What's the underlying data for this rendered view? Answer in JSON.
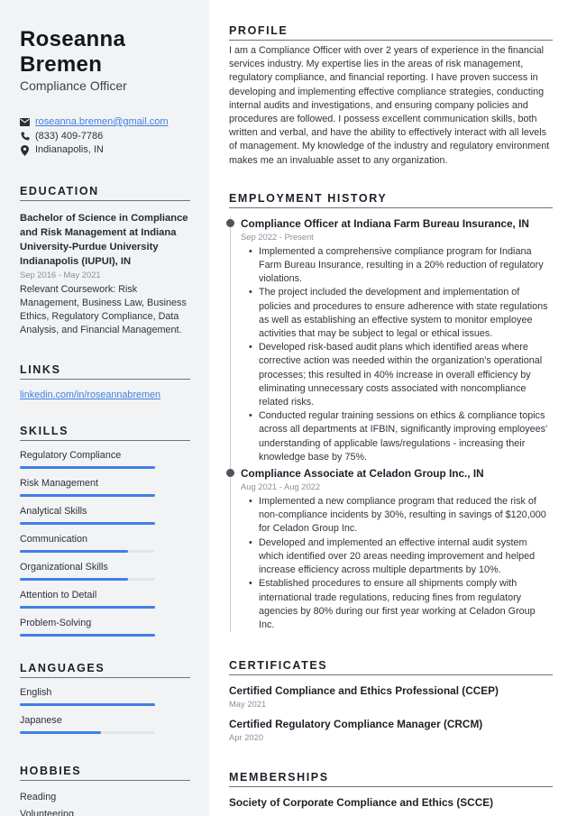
{
  "person": {
    "first_name": "Roseanna",
    "last_name": "Bremen",
    "title": "Compliance Officer"
  },
  "contacts": [
    {
      "icon": "envelope-icon",
      "value": "roseanna.bremen@gmail.com",
      "link": true
    },
    {
      "icon": "phone-icon",
      "value": "(833) 409-7786",
      "link": false
    },
    {
      "icon": "map-pin-icon",
      "value": "Indianapolis, IN",
      "link": false
    }
  ],
  "education": {
    "heading": "EDUCATION",
    "degree": "Bachelor of Science in Compliance and Risk Management at Indiana University-Purdue University Indianapolis (IUPUI), IN",
    "dates": "Sep 2016 - May 2021",
    "description": "Relevant Coursework: Risk Management, Business Law, Business Ethics, Regulatory Compliance, Data Analysis, and Financial Management."
  },
  "links": {
    "heading": "LINKS",
    "items": [
      "linkedin.com/in/roseannabremen"
    ]
  },
  "skills": {
    "heading": "SKILLS",
    "items": [
      {
        "label": "Regulatory Compliance",
        "level": 1.0
      },
      {
        "label": "Risk Management",
        "level": 1.0
      },
      {
        "label": "Analytical Skills",
        "level": 1.0
      },
      {
        "label": "Communication",
        "level": 0.8
      },
      {
        "label": "Organizational Skills",
        "level": 0.8
      },
      {
        "label": "Attention to Detail",
        "level": 1.0
      },
      {
        "label": "Problem-Solving",
        "level": 1.0
      }
    ]
  },
  "languages": {
    "heading": "LANGUAGES",
    "items": [
      {
        "label": "English",
        "level": 1.0
      },
      {
        "label": "Japanese",
        "level": 0.6
      }
    ]
  },
  "hobbies": {
    "heading": "HOBBIES",
    "items": [
      "Reading",
      "Volunteering"
    ]
  },
  "profile": {
    "heading": "PROFILE",
    "text": "I am a Compliance Officer with over 2 years of experience in the financial services industry. My expertise lies in the areas of risk management, regulatory compliance, and financial reporting. I have proven success in developing and implementing effective compliance strategies, conducting internal audits and investigations, and ensuring company policies and procedures are followed. I possess excellent communication skills, both written and verbal, and have the ability to effectively interact with all levels of management. My knowledge of the industry and regulatory environment makes me an invaluable asset to any organization."
  },
  "employment": {
    "heading": "EMPLOYMENT HISTORY",
    "jobs": [
      {
        "title": "Compliance Officer at Indiana Farm Bureau Insurance, IN",
        "dates": "Sep 2022 - Present",
        "bullets": [
          "Implemented a comprehensive compliance program for Indiana Farm Bureau Insurance, resulting in a 20% reduction of regulatory violations.",
          "The project included the development and implementation of policies and procedures to ensure adherence with state regulations as well as establishing an effective system to monitor employee activities that may be subject to legal or ethical issues.",
          "Developed risk-based audit plans which identified areas where corrective action was needed within the organization's operational processes; this resulted in 40% increase in overall efficiency by eliminating unnecessary costs associated with noncompliance related risks.",
          "Conducted regular training sessions on ethics & compliance topics across all departments at IFBIN, significantly improving employees' understanding of applicable laws/regulations - increasing their knowledge base by 75%."
        ]
      },
      {
        "title": "Compliance Associate at Celadon Group Inc., IN",
        "dates": "Aug 2021 - Aug 2022",
        "bullets": [
          "Implemented a new compliance program that reduced the risk of non-compliance incidents by 30%, resulting in savings of $120,000 for Celadon Group Inc.",
          "Developed and implemented an effective internal audit system which identified over 20 areas needing improvement and helped increase efficiency across multiple departments by 10%.",
          "Established procedures to ensure all shipments comply with international trade regulations, reducing fines from regulatory agencies by 80% during our first year working at Celadon Group Inc."
        ]
      }
    ]
  },
  "certificates": {
    "heading": "CERTIFICATES",
    "items": [
      {
        "title": "Certified Compliance and Ethics Professional (CCEP)",
        "date": "May 2021"
      },
      {
        "title": "Certified Regulatory Compliance Manager (CRCM)",
        "date": "Apr 2020"
      }
    ]
  },
  "memberships": {
    "heading": "MEMBERSHIPS",
    "items": [
      "Society of Corporate Compliance and Ethics (SCCE)"
    ]
  },
  "colors": {
    "accent": "#3f7fe6",
    "sidebar_bg": "#f2f3f5",
    "link": "#3f7fe0"
  }
}
